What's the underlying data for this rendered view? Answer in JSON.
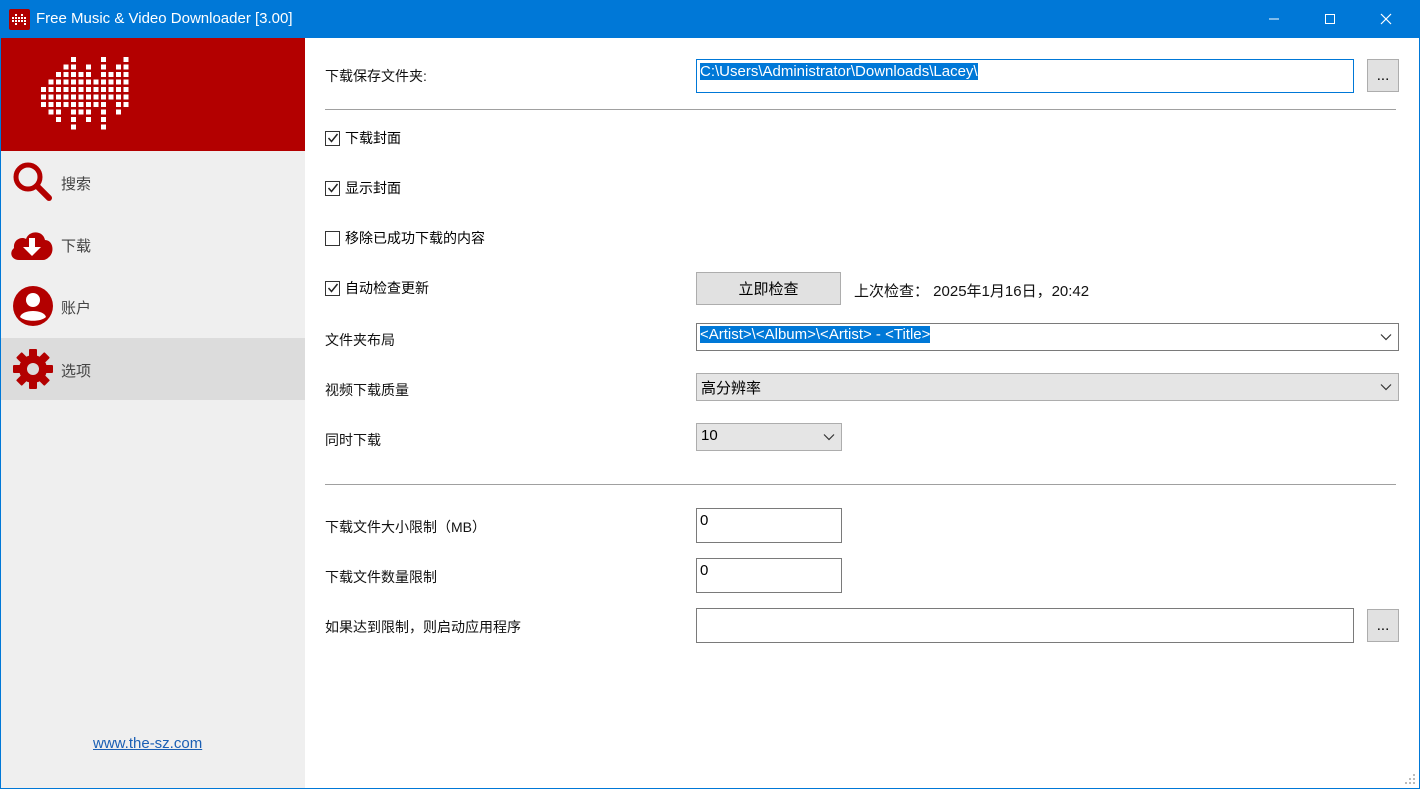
{
  "window": {
    "title": "Free Music & Video Downloader [3.00]"
  },
  "sidebar": {
    "items": [
      {
        "label": "搜索",
        "icon": "search-icon"
      },
      {
        "label": "下载",
        "icon": "cloud-download-icon"
      },
      {
        "label": "账户",
        "icon": "account-icon"
      },
      {
        "label": "选项",
        "icon": "gear-icon",
        "active": true
      }
    ],
    "link": "www.the-sz.com"
  },
  "options": {
    "folder_label": "下载保存文件夹:",
    "folder_value": "C:\\Users\\Administrator\\Downloads\\Lacey\\",
    "browse_label": "...",
    "download_cover": {
      "label": "下载封面",
      "checked": true
    },
    "show_cover": {
      "label": "显示封面",
      "checked": true
    },
    "remove_done": {
      "label": "移除已成功下载的内容",
      "checked": false
    },
    "auto_update": {
      "label": "自动检查更新",
      "checked": true
    },
    "check_now_label": "立即检查",
    "last_check": "上次检查： 2025年1月16日，20:42",
    "layout_label": "文件夹布局",
    "layout_value": "<Artist>\\<Album>\\<Artist> - <Title>",
    "quality_label": "视频下载质量",
    "quality_value": "高分辨率",
    "concurrent_label": "同时下载",
    "concurrent_value": "10",
    "size_limit_label": "下载文件大小限制（MB）",
    "size_limit_value": "0",
    "count_limit_label": "下载文件数量限制",
    "count_limit_value": "0",
    "run_app_label": "如果达到限制，则启动应用程序",
    "run_app_value": "",
    "browse2_label": "..."
  },
  "colors": {
    "accent": "#0078d7",
    "brand": "#b30000"
  }
}
